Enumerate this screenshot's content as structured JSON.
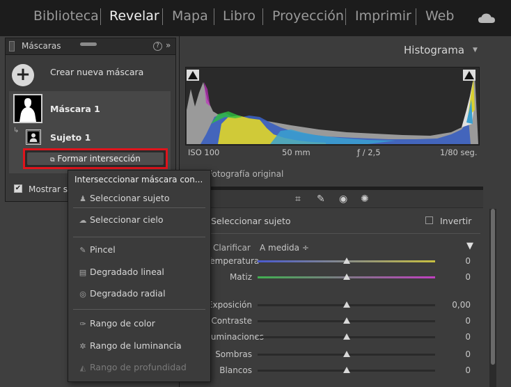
{
  "modules": [
    {
      "label": "Biblioteca",
      "active": false
    },
    {
      "label": "Revelar",
      "active": true
    },
    {
      "label": "Mapa",
      "active": false
    },
    {
      "label": "Libro",
      "active": false
    },
    {
      "label": "Proyección",
      "active": false
    },
    {
      "label": "Imprimir",
      "active": false
    },
    {
      "label": "Web",
      "active": false
    }
  ],
  "masks_panel": {
    "title": "Máscaras",
    "help": "?",
    "collapse": "»",
    "create_label": "Crear nueva máscara",
    "mask1_label": "Máscara 1",
    "subject_label": "Sujeto 1",
    "intersect_label": "Formar intersección",
    "show_overlay_label": "Mostrar superposición"
  },
  "histogram": {
    "title": "Histograma",
    "iso": "ISO 100",
    "focal": "50 mm",
    "aperture": "ƒ / 2,5",
    "shutter": "1/80 seg.",
    "original_label": "Fotografía original"
  },
  "mask_settings": {
    "select_subject": "Seleccionar sujeto",
    "invert_label": "Invertir",
    "preset_label": "Clarificar",
    "preset_value": "A medida ÷",
    "sliders": [
      {
        "label": "Temperatura",
        "value": "0",
        "pos": 0.5
      },
      {
        "label": "Matiz",
        "value": "0",
        "pos": 0.5
      },
      {
        "label": "Exposición",
        "value": "0,00",
        "pos": 0.5
      },
      {
        "label": "Contraste",
        "value": "0",
        "pos": 0.5
      },
      {
        "label": "Iluminaciones",
        "value": "0",
        "pos": 0.5
      },
      {
        "label": "Sombras",
        "value": "0",
        "pos": 0.5
      },
      {
        "label": "Blancos",
        "value": "0",
        "pos": 0.5
      }
    ]
  },
  "menu": {
    "title": "Intersecccionar máscara con...",
    "items": [
      {
        "label": "Seleccionar sujeto",
        "icon": "subject-icon",
        "disabled": false
      },
      {
        "label": "Seleccionar cielo",
        "icon": "sky-icon",
        "disabled": false
      },
      {
        "label": "Pincel",
        "icon": "brush-icon",
        "disabled": false
      },
      {
        "label": "Degradado lineal",
        "icon": "linear-gradient-icon",
        "disabled": false
      },
      {
        "label": "Degradado radial",
        "icon": "radial-gradient-icon",
        "disabled": false
      },
      {
        "label": "Rango de color",
        "icon": "color-range-icon",
        "disabled": false
      },
      {
        "label": "Rango de luminancia",
        "icon": "luminance-range-icon",
        "disabled": false
      },
      {
        "label": "Rango de profundidad",
        "icon": "depth-range-icon",
        "disabled": true
      }
    ]
  },
  "colors": {
    "highlight_border": "#e0141c",
    "panel_bg": "#3a3a3a"
  }
}
